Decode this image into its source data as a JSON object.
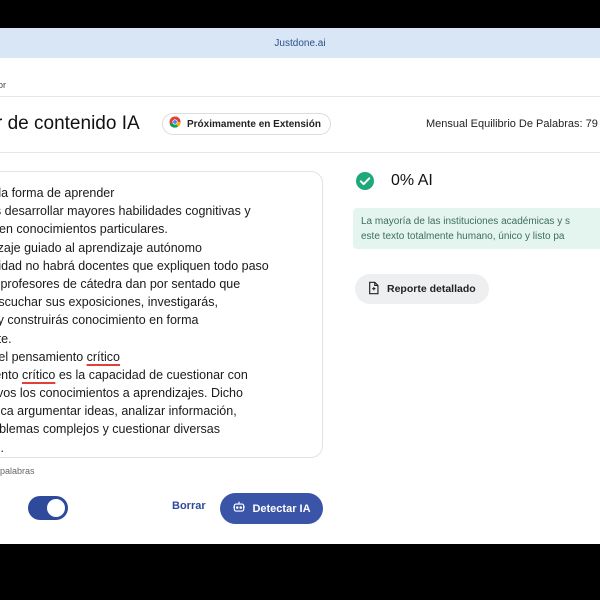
{
  "browser": {
    "url": "Justdone.ai"
  },
  "breadcrumb": "or",
  "header": {
    "title": "r de contenido IA",
    "extension_badge": "Próximamente en Extensión",
    "balance": "Mensual Equilibrio De Palabras: 79"
  },
  "editor": {
    "lines": [
      {
        "pre": "en la forma de aprender",
        "err": "",
        "post": ""
      },
      {
        "pre": "bes desarrollar mayores habilidades cognitivas y",
        "err": "",
        "post": ""
      },
      {
        "pre": "rte en conocimientos particulares.",
        "err": "",
        "post": ""
      },
      {
        "pre": "ndizaje guiado al aprendizaje autónomo",
        "err": "",
        "post": ""
      },
      {
        "pre": "ersidad no habrá docentes que expliquen todo paso",
        "err": "",
        "post": ""
      },
      {
        "pre": "los profesores de cátedra dan por sentado que",
        "err": "",
        "post": ""
      },
      {
        "pre": "e escuchar sus exposiciones, investigarás,",
        "err": "",
        "post": ""
      },
      {
        "pre": "ás y construirás conocimiento en forma",
        "err": "",
        "post": ""
      },
      {
        "pre": "iente.",
        "err": "",
        "post": ""
      },
      {
        "pre": "o del pensamiento ",
        "err": "crítico",
        "post": ""
      },
      {
        "pre": "miento ",
        "err": "crítico",
        "post": " es la capacidad de cuestionar con"
      },
      {
        "pre": "exivos los conocimientos a aprendizajes. Dicho",
        "err": "",
        "post": ""
      },
      {
        "pre": "nplica argumentar ideas, analizar información,",
        "err": "",
        "post": ""
      },
      {
        "pre": "problemas complejos y cuestionar diversas",
        "err": "",
        "post": ""
      },
      {
        "pre": "vas.",
        "err": "",
        "post": ""
      }
    ],
    "word_count": "palabras"
  },
  "actions": {
    "toggle_on": true,
    "clear_label": "Borrar",
    "detect_label": "Detectar IA"
  },
  "result": {
    "score": "0% AI",
    "message_lines": [
      "La mayoría de las instituciones académicas y s",
      "este texto totalmente humano, único y listo pa"
    ],
    "report_label": "Reporte detallado"
  },
  "colors": {
    "accent": "#3a54a8",
    "success": "#1fa97a",
    "banner_bg": "#e3f5ee"
  },
  "icons": {
    "badge": "chrome-icon",
    "result": "check-circle-icon",
    "detect": "robot-icon",
    "report": "document-icon"
  }
}
